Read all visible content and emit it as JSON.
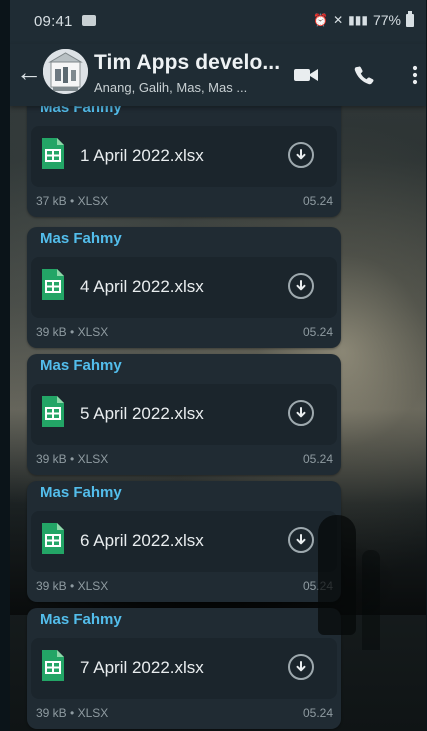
{
  "status_bar": {
    "time": "09:41",
    "battery": "77%"
  },
  "header": {
    "title": "Tim Apps develo...",
    "subtitle": "Anang, Galih, Mas, Mas ..."
  },
  "messages": [
    {
      "sender": "Mas Fahmy",
      "file_name": "1 April 2022.xlsx",
      "size": "37 kB",
      "type": "XLSX",
      "time": "05.24"
    },
    {
      "sender": "Mas Fahmy",
      "file_name": "4 April 2022.xlsx",
      "size": "39 kB",
      "type": "XLSX",
      "time": "05.24"
    },
    {
      "sender": "Mas Fahmy",
      "file_name": "5 April 2022.xlsx",
      "size": "39 kB",
      "type": "XLSX",
      "time": "05.24"
    },
    {
      "sender": "Mas Fahmy",
      "file_name": "6 April 2022.xlsx",
      "size": "39 kB",
      "type": "XLSX",
      "time": "05.24"
    },
    {
      "sender": "Mas Fahmy",
      "file_name": "7 April 2022.xlsx",
      "size": "39 kB",
      "type": "XLSX",
      "time": "05.24"
    }
  ],
  "icons": {
    "back": "arrow-left",
    "video": "video-camera",
    "call": "phone",
    "menu": "vertical-ellipsis",
    "file": "spreadsheet-file",
    "download": "download-arrow"
  },
  "colors": {
    "header_background": "#1f2c34",
    "message_background": "#202b33",
    "sender": "#53bdeb",
    "spreadsheet": "#23a566"
  }
}
